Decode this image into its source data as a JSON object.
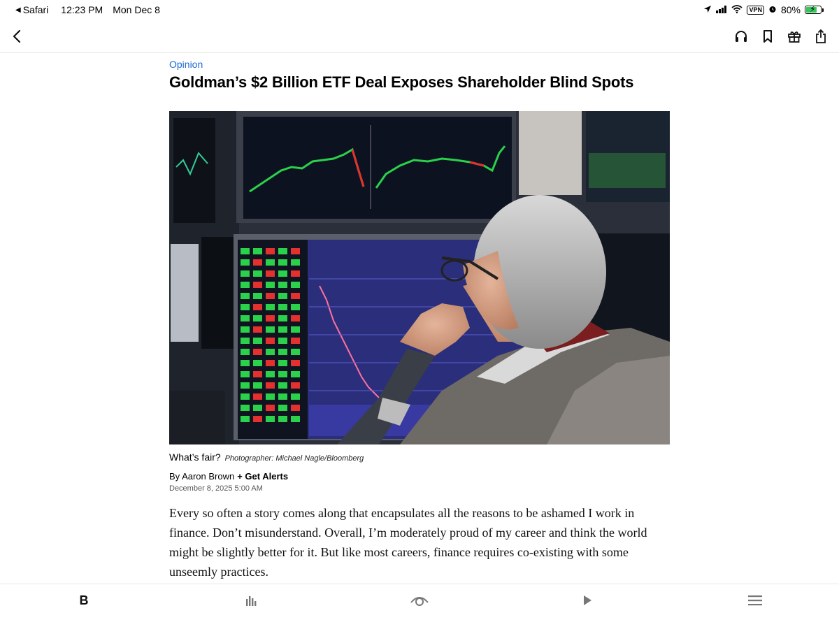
{
  "status_bar": {
    "back_app": "Safari",
    "time": "12:23 PM",
    "date": "Mon Dec 8",
    "vpn": "VPN",
    "battery": "80%",
    "battery_level": 0.8
  },
  "nav": {
    "back_icon": "chevron-left-icon",
    "actions": [
      "headphones-icon",
      "bookmark-icon",
      "gift-icon",
      "share-icon"
    ]
  },
  "article": {
    "section": "Opinion",
    "headline": "Goldman’s $2 Billion ETF Deal Exposes Shareholder Blind Spots",
    "image_alt": "Trader looking at market screens",
    "caption": "What’s fair?",
    "photo_credit": "Photographer: Michael Nagle/Bloomberg",
    "byline": "By Aaron Brown",
    "alerts": "+ Get Alerts",
    "dateline": "December 8, 2025 5:00 AM",
    "body": "Every so often a story comes along that encapsulates all the reasons to be ashamed I work in finance. Don’t misunderstand. Overall, I’m moderately proud of my career and think the world might be slightly better for it. But like most careers, finance requires co-existing with some unseemly practices."
  },
  "tab_bar": {
    "home_label": "B",
    "tabs": [
      "home-icon",
      "markets-icon",
      "watch-icon",
      "play-icon",
      "menu-icon"
    ]
  },
  "colors": {
    "accent": "#1a6ad6",
    "battery_fill": "#34c759",
    "divider": "#e5e5e5"
  }
}
